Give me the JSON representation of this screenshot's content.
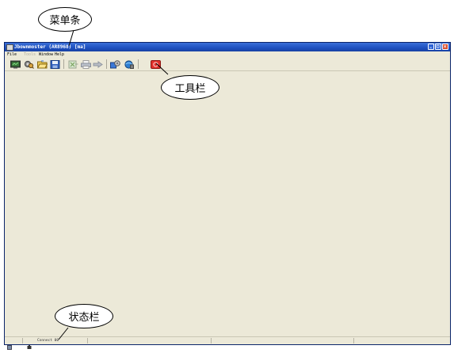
{
  "window": {
    "title": "Jbownmoster (AR8968) [ma]",
    "controls": {
      "minimize": "minimize",
      "maximize": "maximize",
      "close": "close"
    }
  },
  "menubar": {
    "items": [
      {
        "label": "File",
        "enabled": true
      },
      {
        "label": "Tools",
        "enabled": false
      },
      {
        "label": "Window",
        "enabled": true
      },
      {
        "label": "Help",
        "enabled": true
      }
    ]
  },
  "toolbar": {
    "buttons": [
      {
        "name": "monitor-icon",
        "enabled": true
      },
      {
        "name": "gear-search-icon",
        "enabled": true
      },
      {
        "name": "open-folder-icon",
        "enabled": true
      },
      {
        "name": "save-icon",
        "enabled": true
      },
      {
        "name": "export-icon",
        "enabled": false
      },
      {
        "name": "print-icon",
        "enabled": false
      },
      {
        "name": "forward-icon",
        "enabled": false
      },
      {
        "name": "config-icon",
        "enabled": true
      },
      {
        "name": "connect-icon",
        "enabled": true
      },
      {
        "name": "record-icon",
        "enabled": true
      }
    ],
    "accent": "#e0312b"
  },
  "statusbar": {
    "text": "Connect 00"
  },
  "annotations": {
    "menubar_label": "菜单条",
    "toolbar_label": "工具栏",
    "statusbar_label": "状态栏"
  }
}
